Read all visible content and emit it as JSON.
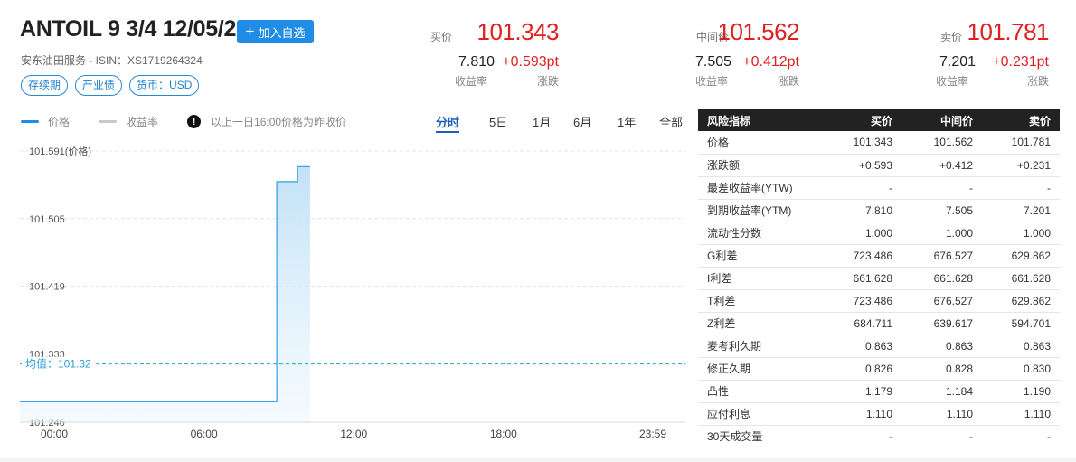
{
  "header": {
    "title": "ANTOIL 9 3/4 12/05/20",
    "watch_button": "加入自选",
    "subtitle": "安东油田服务 - ISIN：XS1719264324",
    "tags": [
      "存续期",
      "产业债",
      "货币：USD"
    ]
  },
  "quotes": [
    {
      "label": "买价",
      "price": "101.343",
      "yield": "7.810",
      "yield_label": "收益率",
      "change": "+0.593pt",
      "change_label": "涨跌"
    },
    {
      "label": "中间价",
      "price": "101.562",
      "yield": "7.505",
      "yield_label": "收益率",
      "change": "+0.412pt",
      "change_label": "涨跌"
    },
    {
      "label": "卖价",
      "price": "101.781",
      "yield": "7.201",
      "yield_label": "收益率",
      "change": "+0.231pt",
      "change_label": "涨跌"
    }
  ],
  "legend": {
    "price": "价格",
    "yield": "收益率",
    "note": "以上一日16:00价格为昨收价"
  },
  "tabs": [
    "分时",
    "5日",
    "1月",
    "6月",
    "1年",
    "全部"
  ],
  "active_tab": "分时",
  "colors": {
    "accent": "#1f8ce6",
    "up": "#e02020",
    "price_line": "#39a6e8",
    "yield_line": "#c8c8c8",
    "avg_line": "#2a9fd6"
  },
  "chart_data": {
    "type": "area",
    "title": "",
    "ylabel": "101.591(价格)",
    "yticks": [
      "101.505",
      "101.419",
      "101.333",
      "101.246"
    ],
    "ylim": [
      101.246,
      101.591
    ],
    "xticks": [
      "00:00",
      "06:00",
      "12:00",
      "18:00",
      "23:59"
    ],
    "x": [
      "00:00",
      "08:55",
      "08:55",
      "09:45",
      "09:45",
      "10:15"
    ],
    "y": [
      101.272,
      101.272,
      101.552,
      101.552,
      101.571,
      101.571
    ],
    "avg_label": "均值：101.32",
    "avg_value": 101.32,
    "grid": true
  },
  "risk_table": {
    "headers": [
      "风险指标",
      "买价",
      "中间价",
      "卖价"
    ],
    "rows": [
      [
        "价格",
        "101.343",
        "101.562",
        "101.781"
      ],
      [
        "涨跌额",
        "+0.593",
        "+0.412",
        "+0.231"
      ],
      [
        "最差收益率(YTW)",
        "-",
        "-",
        "-"
      ],
      [
        "到期收益率(YTM)",
        "7.810",
        "7.505",
        "7.201"
      ],
      [
        "流动性分数",
        "1.000",
        "1.000",
        "1.000"
      ],
      [
        "G利差",
        "723.486",
        "676.527",
        "629.862"
      ],
      [
        "I利差",
        "661.628",
        "661.628",
        "661.628"
      ],
      [
        "T利差",
        "723.486",
        "676.527",
        "629.862"
      ],
      [
        "Z利差",
        "684.711",
        "639.617",
        "594.701"
      ],
      [
        "麦考利久期",
        "0.863",
        "0.863",
        "0.863"
      ],
      [
        "修正久期",
        "0.826",
        "0.828",
        "0.830"
      ],
      [
        "凸性",
        "1.179",
        "1.184",
        "1.190"
      ],
      [
        "应付利息",
        "1.110",
        "1.110",
        "1.110"
      ],
      [
        "30天成交量",
        "-",
        "-",
        "-"
      ]
    ]
  }
}
